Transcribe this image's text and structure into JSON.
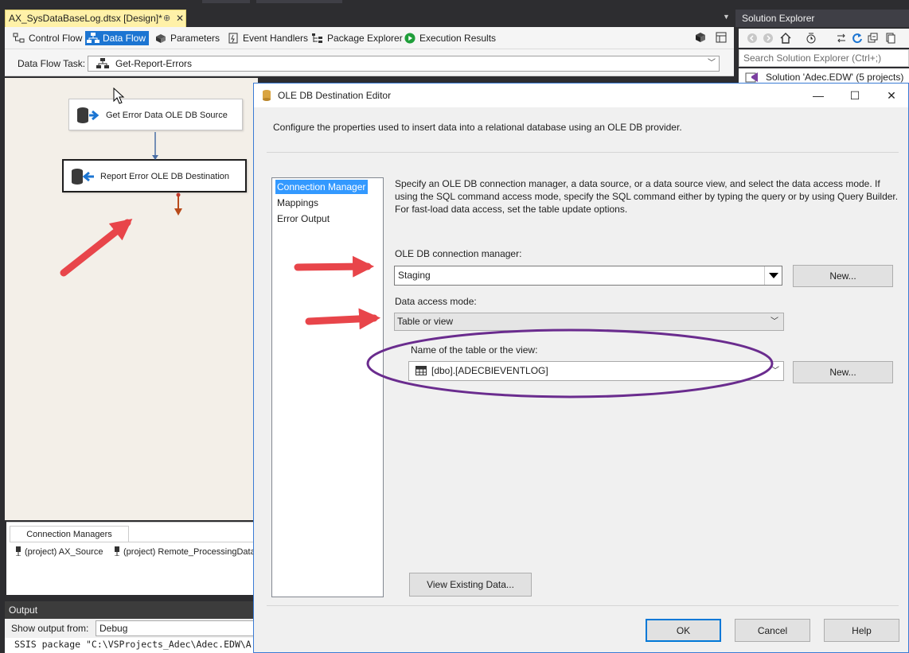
{
  "document_tab": {
    "title": "AX_SysDataBaseLog.dtsx [Design]*",
    "pin": "⊕",
    "close": "✕"
  },
  "designer_tabs": [
    {
      "label": "Control Flow",
      "active": false
    },
    {
      "label": "Data Flow",
      "active": true
    },
    {
      "label": "Parameters",
      "active": false
    },
    {
      "label": "Event Handlers",
      "active": false
    },
    {
      "label": "Package Explorer",
      "active": false
    },
    {
      "label": "Execution Results",
      "active": false
    }
  ],
  "data_flow_task": {
    "label": "Data Flow Task:",
    "value": "Get-Report-Errors"
  },
  "components": {
    "source": "Get Error Data OLE DB Source",
    "destination": "Report Error OLE DB Destination"
  },
  "connection_managers": {
    "tab": "Connection Managers",
    "items": [
      "(project) AX_Source",
      "(project) Remote_ProcessingDatab"
    ]
  },
  "output": {
    "title": "Output",
    "show_from_label": "Show output from:",
    "show_from_value": "Debug",
    "text": "SSIS package \"C:\\VSProjects_Adec\\Adec.EDW\\A"
  },
  "solution_explorer": {
    "title": "Solution Explorer",
    "search_placeholder": "Search Solution Explorer (Ctrl+;)",
    "solution_item": "Solution 'Adec.EDW' (5 projects)"
  },
  "dialog": {
    "title": "OLE DB Destination Editor",
    "description": "Configure the properties used to insert data into a relational database using an OLE DB provider.",
    "nav": [
      {
        "label": "Connection Manager",
        "selected": true
      },
      {
        "label": "Mappings",
        "selected": false
      },
      {
        "label": "Error Output",
        "selected": false
      }
    ],
    "page_description": "Specify an OLE DB connection manager, a data source, or a data source view, and select the data access mode. If using the SQL command access mode, specify the SQL command either by typing the query or by using Query Builder. For fast-load data access, set the table update options.",
    "connection_manager_label": "OLE DB connection manager:",
    "connection_manager_value": "Staging",
    "new_button": "New...",
    "data_access_mode_label": "Data access mode:",
    "data_access_mode_value": "Table or view",
    "table_label": "Name of the table or the view:",
    "table_value": "[dbo].[ADECBIEVENTLOG]",
    "new_button_2": "New...",
    "view_existing_data": "View Existing Data...",
    "ok": "OK",
    "cancel": "Cancel",
    "help": "Help"
  },
  "colors": {
    "annotation_arrow": "#e8454a",
    "annotation_ellipse": "#6a2c8e",
    "selection_blue": "#3399ff",
    "active_tab_blue": "#1c75d2",
    "document_tab_yellow": "#fff1a8"
  }
}
